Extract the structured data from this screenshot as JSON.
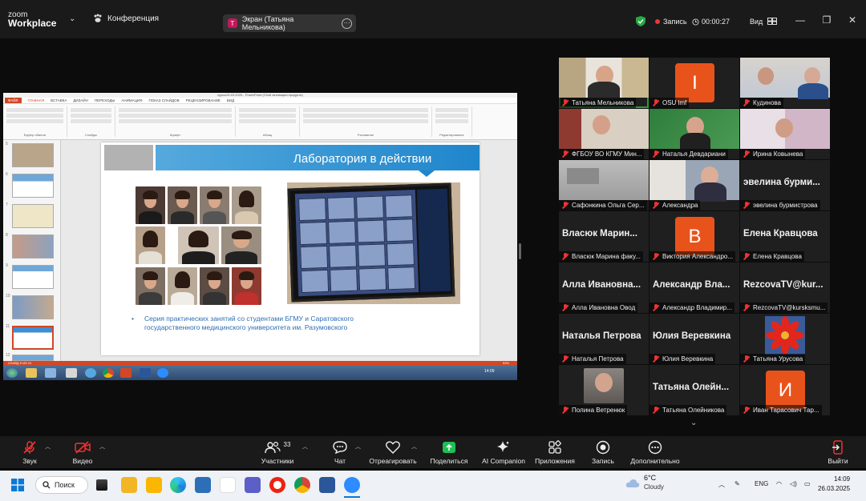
{
  "topbar": {
    "logo_line1": "zoom",
    "logo_line2": "Workplace",
    "meeting_label": "Конференция",
    "screen_share_label": "Экран (Татьяна Мельникова)",
    "screen_share_avatar": "Т",
    "recording_label": "Запись",
    "timer": "00:00:27",
    "view_label": "Вид"
  },
  "shared_screen": {
    "ppt_title": "курсы26.03.2025 - PowerPoint (Сбой активации продукта)",
    "ppt_tabs": [
      "ФАЙЛ",
      "ГЛАВНАЯ",
      "ВСТАВКА",
      "ДИЗАЙН",
      "ПЕРЕХОДЫ",
      "АНИМАЦИЯ",
      "ПОКАЗ СЛАЙДОВ",
      "РЕЦЕНЗИРОВАНИЕ",
      "ВИД"
    ],
    "ribbon_groups": [
      "Буфер обмена",
      "Слайды",
      "Шрифт",
      "Абзац",
      "Рисование",
      "Редактирование"
    ],
    "thumb_numbers": [
      "5",
      "6",
      "7",
      "8",
      "9",
      "10",
      "11",
      "12",
      "13"
    ],
    "slide_title": "Лаборатория в действии",
    "slide_bullet": "Серия практических занятий со студентами БГМУ и Саратовского государственного медицинского университета им. Разумовского",
    "status_left": "СЛАЙД 9 ИЗ 24",
    "status_right": "93%",
    "win7_clock": "14:09"
  },
  "participants": [
    {
      "name": "Татьяна Мельникова",
      "type": "video",
      "speaking": true
    },
    {
      "name": "OSU lmf",
      "type": "letter",
      "letter": "I"
    },
    {
      "name": "Кудинова",
      "type": "video"
    },
    {
      "name": "ФГБОУ ВО КГМУ Мин...",
      "type": "video"
    },
    {
      "name": "Наталья Девдариани",
      "type": "video"
    },
    {
      "name": "Ирина Ковынева",
      "type": "video"
    },
    {
      "name": "Сафонкина Ольга Сер...",
      "type": "video"
    },
    {
      "name": "Александра",
      "type": "video"
    },
    {
      "name": "эвелина бурмистрова",
      "type": "name",
      "display": "эвелина бурми..."
    },
    {
      "name": "Власюк Марина факу...",
      "type": "name",
      "display": "Власюк Марин..."
    },
    {
      "name": "Виктория Александро...",
      "type": "letter",
      "letter": "В"
    },
    {
      "name": "Елена Кравцова",
      "type": "name",
      "display": "Елена Кравцова"
    },
    {
      "name": "Алла Ивановна Овод",
      "type": "name",
      "display": "Алла Ивановна..."
    },
    {
      "name": "Александр Владимир...",
      "type": "name",
      "display": "Александр Вла..."
    },
    {
      "name": "RezcovaTV@kursksmu...",
      "type": "name",
      "display": "RezcovaTV@kur..."
    },
    {
      "name": "Наталья Петрова",
      "type": "name",
      "display": "Наталья Петрова"
    },
    {
      "name": "Юлия Веревкина",
      "type": "name",
      "display": "Юлия Веревкина"
    },
    {
      "name": "Татьяна Урусова",
      "type": "video"
    },
    {
      "name": "Полина Ветренюк",
      "type": "video"
    },
    {
      "name": "Татьяна Олейникова",
      "type": "name",
      "display": "Татьяна Олейн..."
    },
    {
      "name": "Иван Тарасович Тар...",
      "type": "letter",
      "letter": "И"
    }
  ],
  "controls": {
    "audio": "Звук",
    "video": "Видео",
    "participants": "Участники",
    "participants_count": "33",
    "chat": "Чат",
    "react": "Отреагировать",
    "share": "Поделиться",
    "companion": "AI Companion",
    "apps": "Приложения",
    "record": "Запись",
    "more": "Дополнительно",
    "leave": "Выйти"
  },
  "taskbar": {
    "search_label": "Поиск",
    "weather_temp": "6°C",
    "weather_desc": "Cloudy",
    "lang": "ENG",
    "time": "14:09",
    "date": "26.03.2025"
  },
  "colors": {
    "zoom_bg": "#0c0c0c",
    "accent_green": "#2e9a3c",
    "letter_orange": "#e8531c",
    "ppt_orange": "#d24726",
    "slide_blue": "#1f86cc"
  }
}
